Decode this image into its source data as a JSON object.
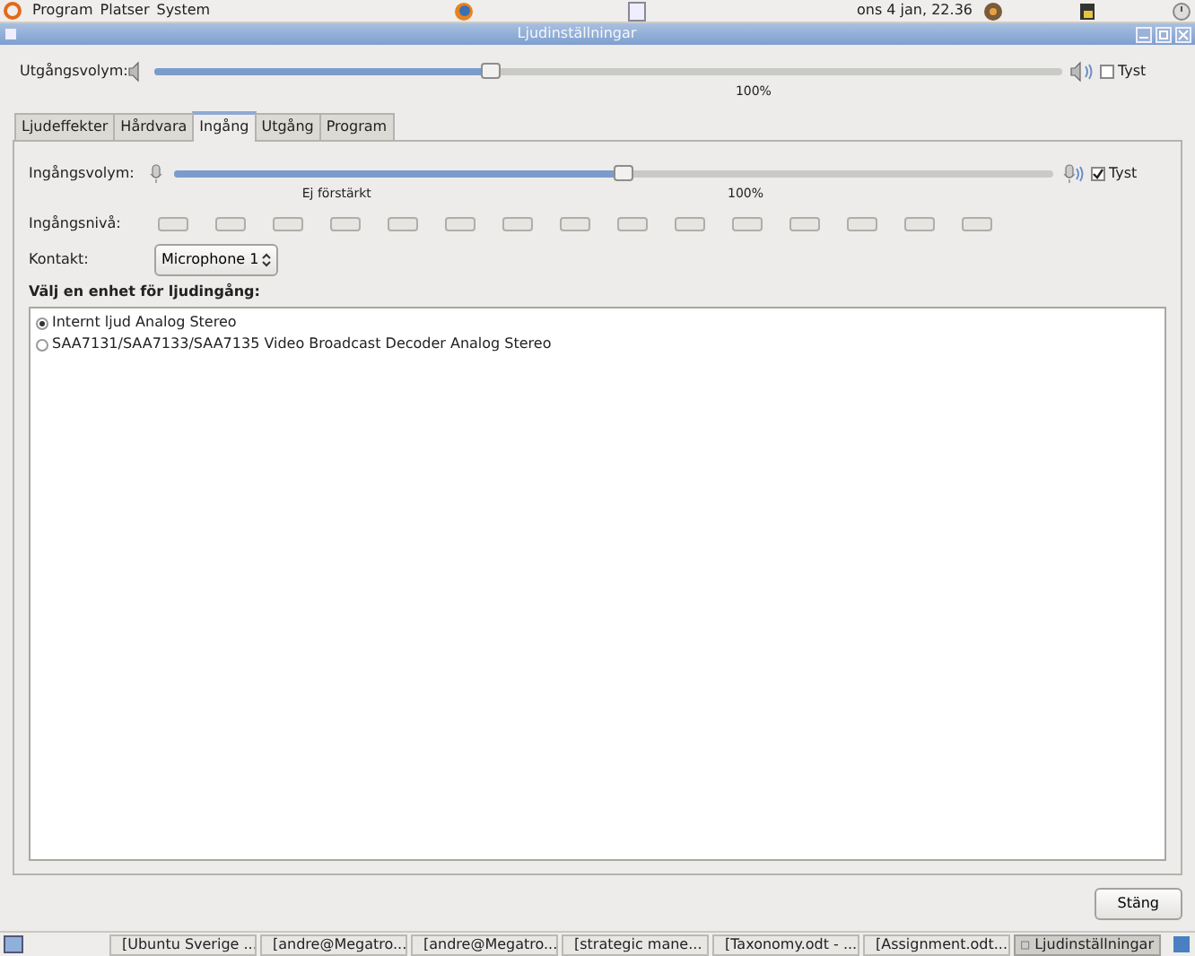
{
  "top_panel": {
    "menus": [
      "Program",
      "Platser",
      "System"
    ],
    "clock": "ons  4 jan, 22.36"
  },
  "window": {
    "title": "Ljudinställningar"
  },
  "output_volume": {
    "label": "Utgångsvolym:",
    "level": 0.37,
    "marks": [
      "100%"
    ],
    "mute_label": "Tyst",
    "muted": false
  },
  "tabs": [
    {
      "label": "Ljudeffekter",
      "selected": false
    },
    {
      "label": "Hårdvara",
      "selected": false
    },
    {
      "label": "Ingång",
      "selected": true
    },
    {
      "label": "Utgång",
      "selected": false
    },
    {
      "label": "Program",
      "selected": false
    }
  ],
  "input_volume": {
    "label": "Ingångsvolym:",
    "level": 0.51,
    "marks": [
      "Ej förstärkt",
      "100%"
    ],
    "mute_label": "Tyst",
    "muted": true
  },
  "input_level": {
    "label": "Ingångsnivå:"
  },
  "connector": {
    "label": "Kontakt:",
    "value": "Microphone 1"
  },
  "device_list": {
    "heading": "Välj en enhet för ljudingång:",
    "items": [
      {
        "label": "Internt ljud Analog Stereo",
        "selected": true
      },
      {
        "label": "SAA7131/SAA7133/SAA7135 Video Broadcast Decoder Analog Stereo",
        "selected": false
      }
    ]
  },
  "buttons": [
    "Stäng"
  ],
  "taskbar": [
    {
      "label": "[Ubuntu Sverige ...",
      "selected": false
    },
    {
      "label": "[andre@Megatro...",
      "selected": false
    },
    {
      "label": "[andre@Megatro...",
      "selected": false
    },
    {
      "label": "[strategic mane...",
      "selected": false
    },
    {
      "label": "[Taxonomy.odt - ...",
      "selected": false
    },
    {
      "label": "[Assignment.odt...",
      "selected": false
    },
    {
      "label": "Ljudinställningar",
      "selected": true
    }
  ]
}
